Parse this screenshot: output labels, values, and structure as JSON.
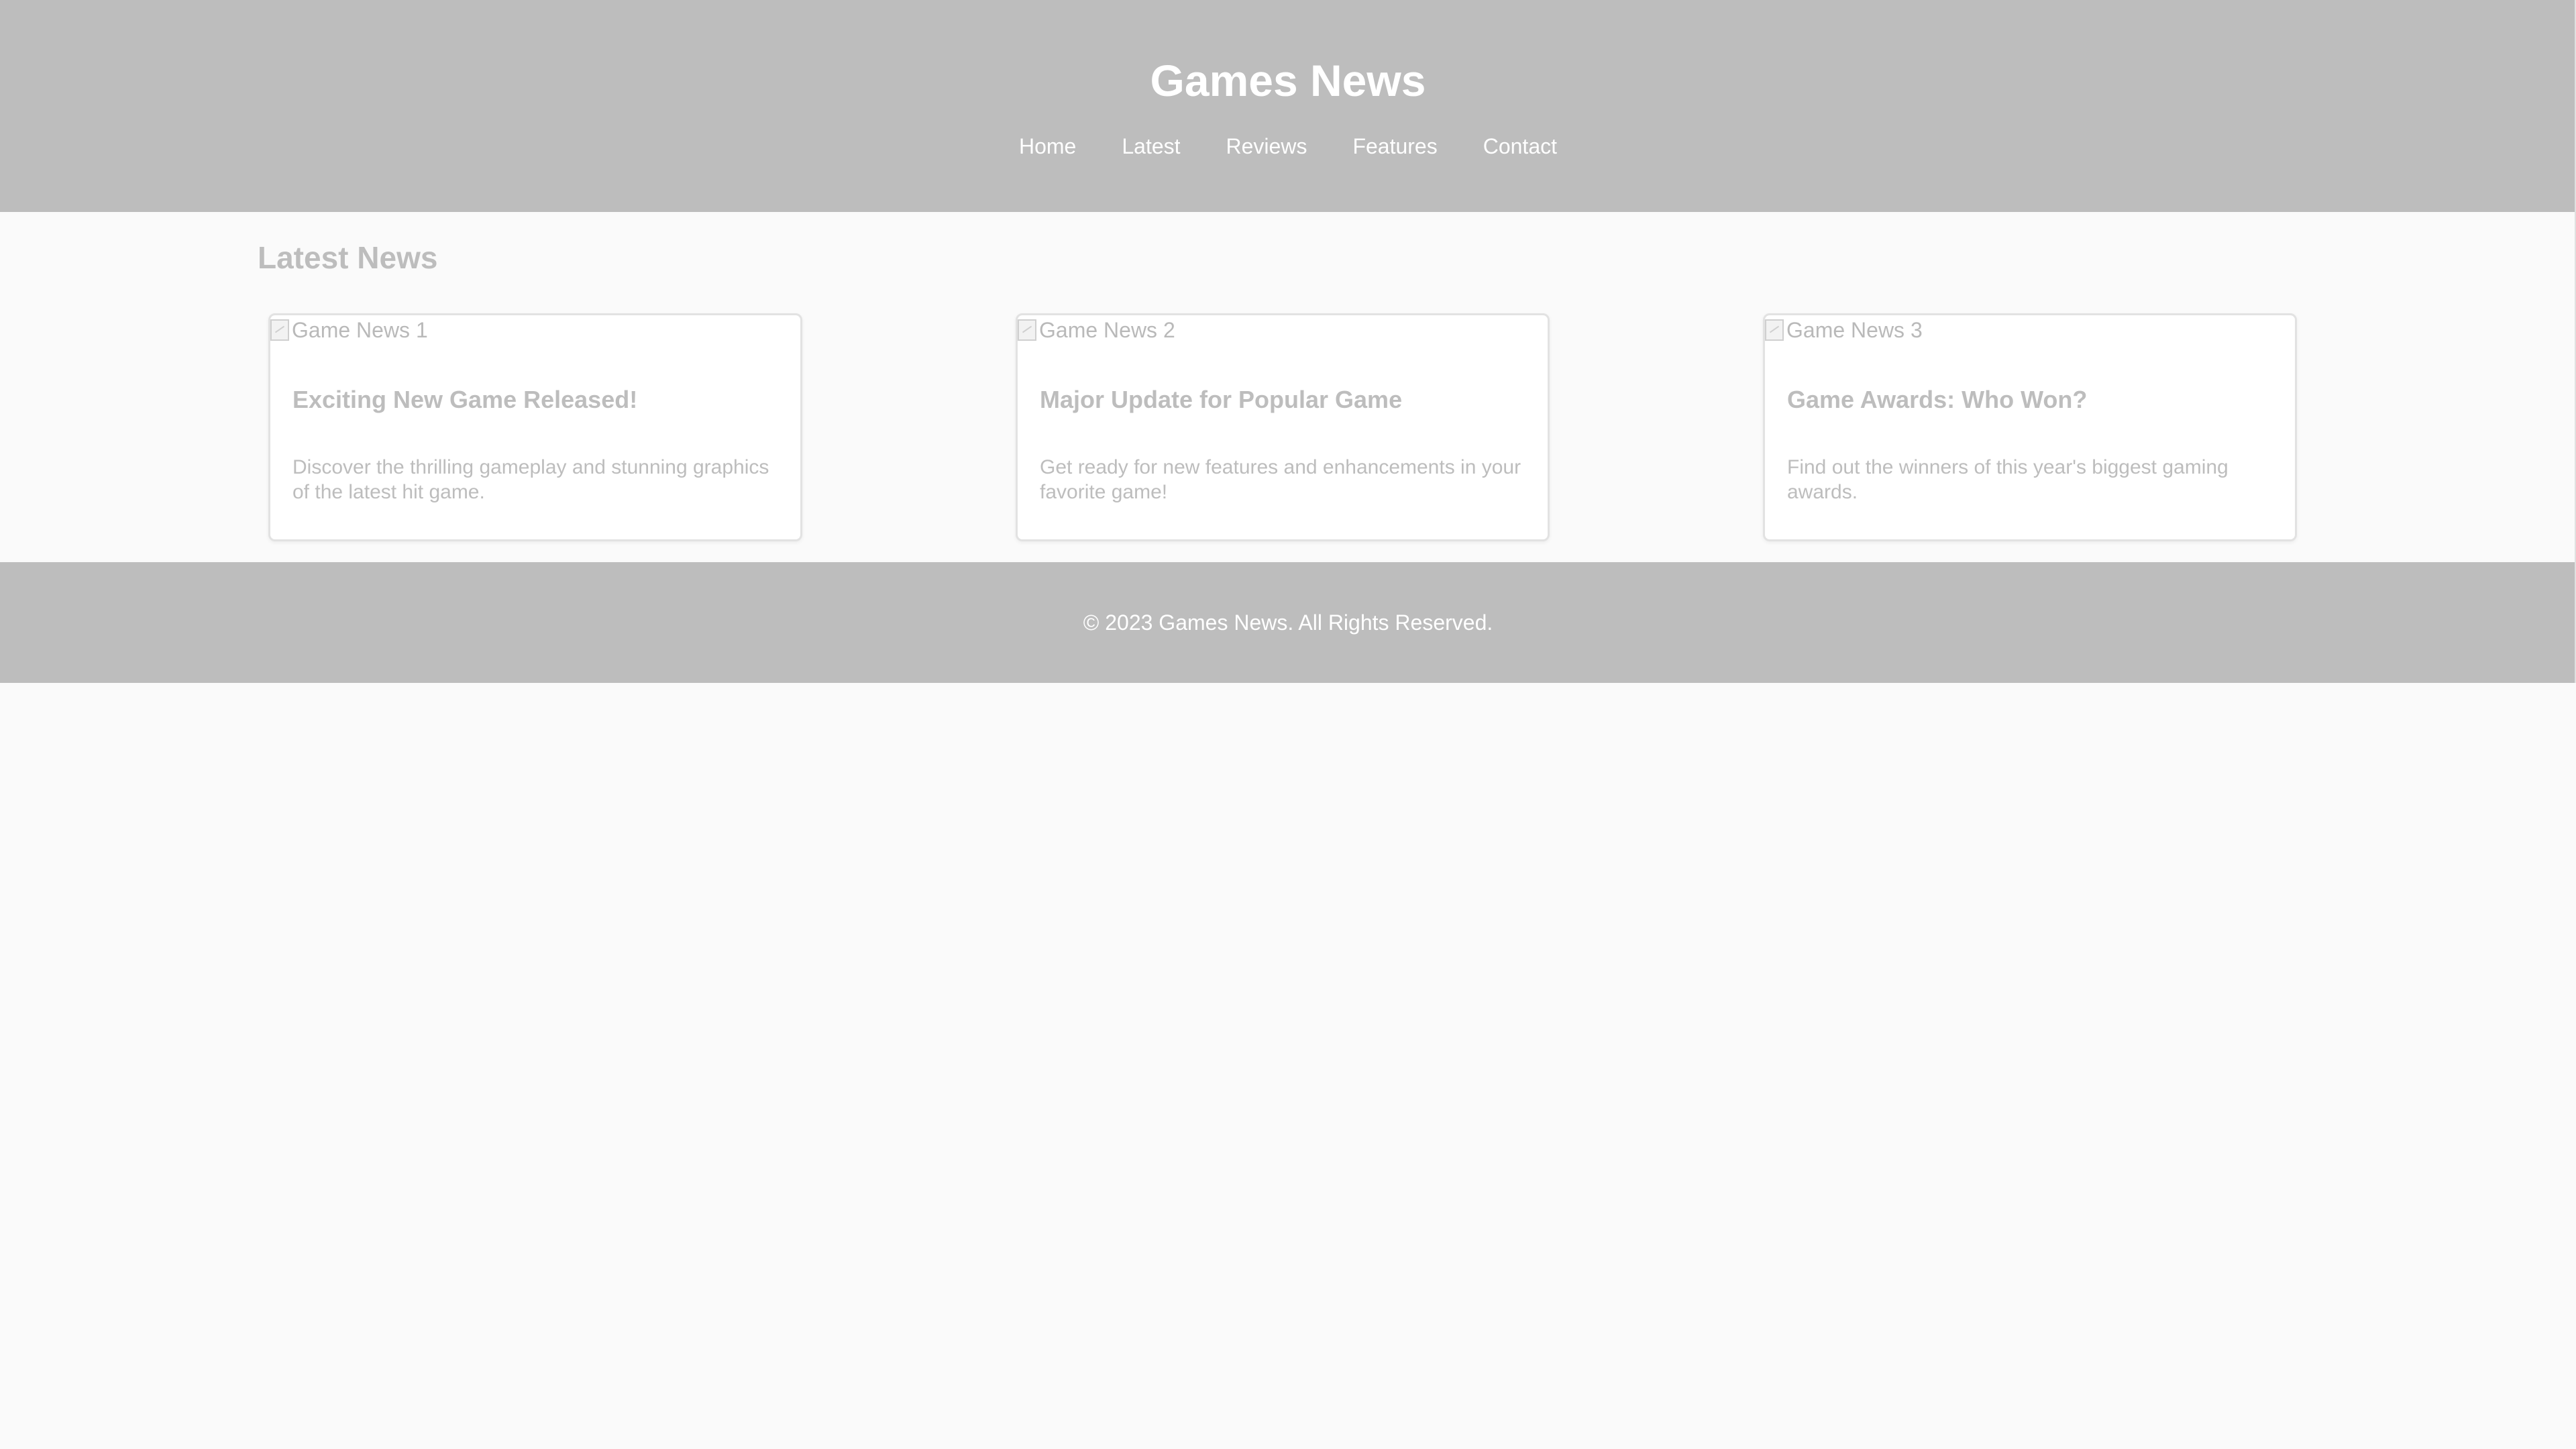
{
  "header": {
    "title": "Games News",
    "nav": [
      "Home",
      "Latest",
      "Reviews",
      "Features",
      "Contact"
    ]
  },
  "main": {
    "section_title": "Latest News",
    "cards": [
      {
        "image_alt": "Game News 1",
        "title": "Exciting New Game Released!",
        "description": "Discover the thrilling gameplay and stunning graphics of the latest hit game."
      },
      {
        "image_alt": "Game News 2",
        "title": "Major Update for Popular Game",
        "description": "Get ready for new features and enhancements in your favorite game!"
      },
      {
        "image_alt": "Game News 3",
        "title": "Game Awards: Who Won?",
        "description": "Find out the winners of this year's biggest gaming awards."
      }
    ]
  },
  "footer": {
    "text": "© 2023 Games News. All Rights Reserved."
  },
  "colors": {
    "header_bg": "#bdbdbd",
    "page_bg": "#fafafa",
    "card_bg": "#ffffff",
    "muted_text": "#bdbdbd",
    "header_text": "#ffffff"
  },
  "icons": [
    "broken-image-icon"
  ]
}
